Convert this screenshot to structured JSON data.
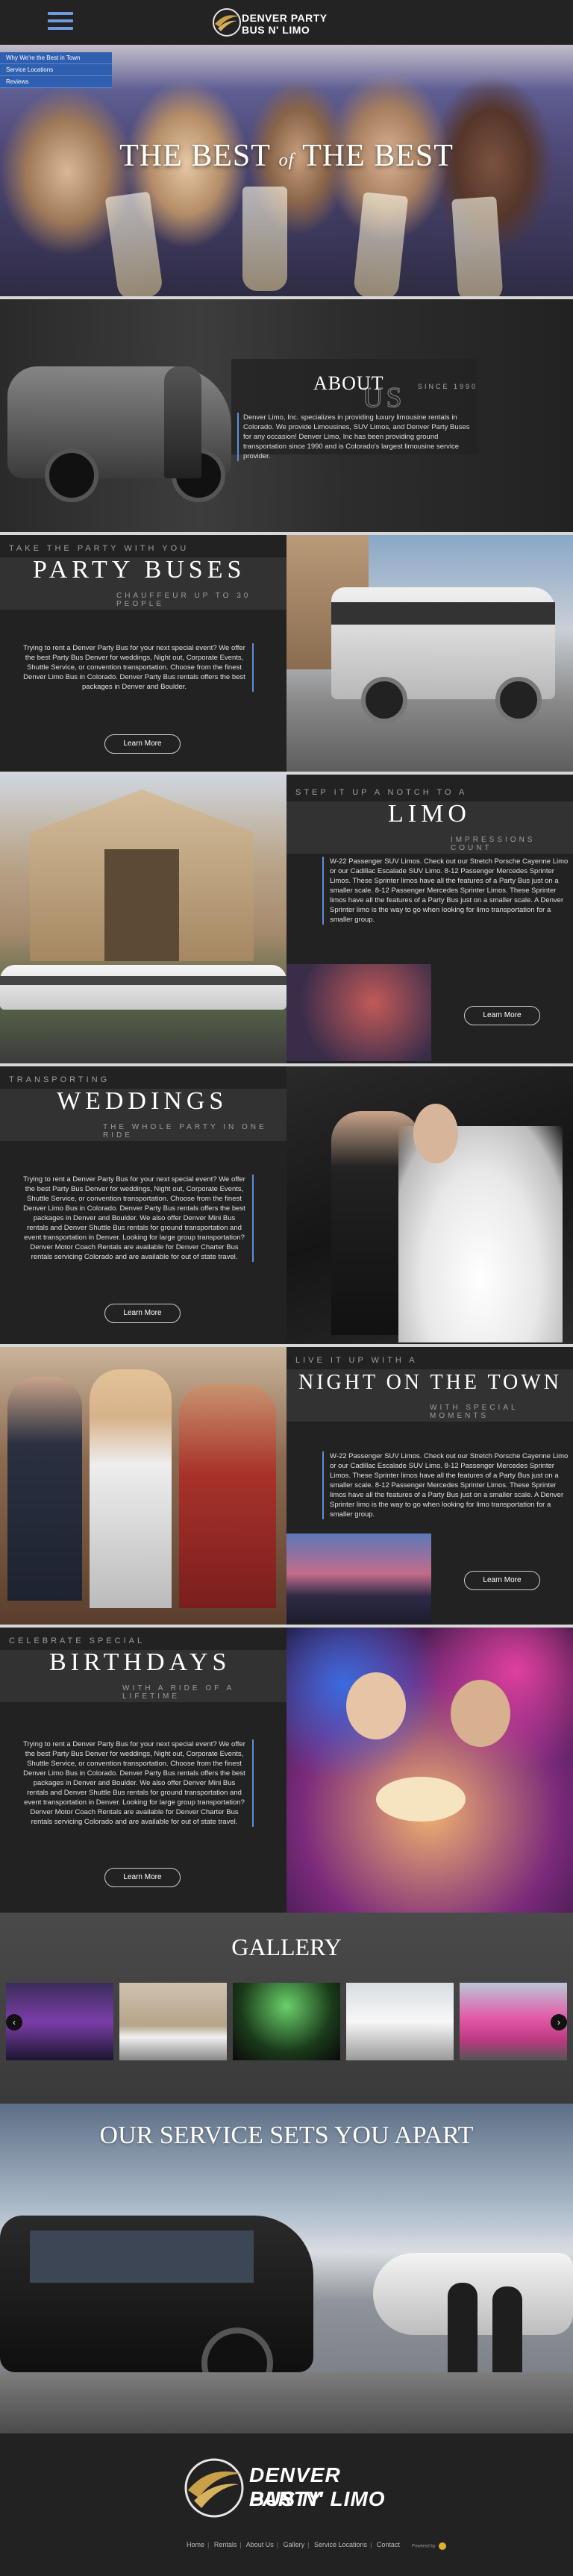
{
  "header": {
    "logo_line1": "DENVER PARTY",
    "logo_line2": "BUS N' LIMO"
  },
  "menu": [
    "Why We're the Best in Town",
    "Service Locations",
    "Reviews"
  ],
  "hero": {
    "title_part1": "THE BEST",
    "title_of": "of",
    "title_part2": "THE BEST"
  },
  "about": {
    "title": "ABOUT",
    "us": "US",
    "since": "SINCE 1990",
    "text": "Denver Limo, Inc. specializes in providing luxury limousine rentals in Colorado. We provide Limousines, SUV Limos, and Denver Party Buses for any occasion! Denver Limo, Inc has been providing ground transportation since 1990 and is Colorado's largest limousine service provider."
  },
  "sections": {
    "party_buses": {
      "eyebrow": "TAKE THE PARTY WITH YOU",
      "title": "PARTY BUSES",
      "subtitle": "CHAUFFEUR UP TO 30 PEOPLE",
      "text": "Trying to rent a Denver Party Bus for your next special event? We offer the best Party Bus Denver for weddings, Night out, Corporate Events, Shuttle Service, or convention transportation. Choose from the finest Denver Limo Bus in Colorado. Denver Party Bus rentals offers the best packages in Denver and Boulder.",
      "button": "Learn More"
    },
    "limo": {
      "eyebrow": "STEP IT UP A NOTCH TO A",
      "title": "LIMO",
      "subtitle": "IMPRESSIONS COUNT",
      "text": "W-22 Passenger SUV Limos. Check out our Stretch Porsche Cayenne Limo or our Cadillac Escalade SUV Limo. 8-12 Passenger Mercedes Sprinter Limos. These Sprinter limos have all the features of a Party Bus just on a smaller scale. 8-12 Passenger Mercedes Sprinter Limos. These Sprinter limos have all the features of a Party Bus just on a smaller scale. A Denver Sprinter limo is the way to go when looking for limo transportation for a smaller group.",
      "button": "Learn More"
    },
    "weddings": {
      "eyebrow": "TRANSPORTING",
      "title": "WEDDINGS",
      "subtitle": "THE WHOLE PARTY IN ONE RIDE",
      "text": "Trying to rent a Denver Party Bus for your next special event? We offer the best Party Bus Denver for weddings, Night out, Corporate Events, Shuttle Service, or convention transportation. Choose from the finest Denver Limo Bus in Colorado. Denver Party Bus rentals offers the best packages in Denver and Boulder. We also offer Denver Mini Bus rentals and Denver Shuttle Bus rentals for ground transportation and event transportation in Denver. Looking for large group transportation? Denver Motor Coach Rentals are available for Denver Charter Bus rentals servicing Colorado and are available for out of state travel.",
      "button": "Learn More"
    },
    "night": {
      "eyebrow": "LIVE IT UP WITH A",
      "title": "NIGHT ON THE TOWN",
      "subtitle": "WITH SPECIAL MOMENTS",
      "text": "W-22 Passenger SUV Limos. Check out our Stretch Porsche Cayenne Limo or our Cadillac Escalade SUV Limo. 8-12 Passenger Mercedes Sprinter Limos. These Sprinter limos have all the features of a Party Bus just on a smaller scale. 8-12 Passenger Mercedes Sprinter Limos. These Sprinter limos have all the features of a Party Bus just on a smaller scale. A Denver Sprinter limo is the way to go when looking for limo transportation for a smaller group.",
      "button": "Learn More"
    },
    "birthdays": {
      "eyebrow": "CELEBRATE SPECIAL",
      "title": "BIRTHDAYS",
      "subtitle": "WITH A RIDE OF A LIFETIME",
      "text": "Trying to rent a Denver Party Bus for your next special event? We offer the best Party Bus Denver for weddings, Night out, Corporate Events, Shuttle Service, or convention transportation. Choose from the finest Denver Limo Bus in Colorado. Denver Party Bus rentals offers the best packages in Denver and Boulder. We also offer Denver Mini Bus rentals and Denver Shuttle Bus rentals for ground transportation and event transportation in Denver. Looking for large group transportation? Denver Motor Coach Rentals are available for Denver Charter Bus rentals servicing Colorado and are available for out of state travel.",
      "button": "Learn More"
    }
  },
  "gallery": {
    "title": "GALLERY",
    "prev": "‹",
    "next": "›"
  },
  "service": {
    "title": "OUR SERVICE SETS YOU APART"
  },
  "footer": {
    "logo_line1": "DENVER PARTY",
    "logo_line2": "BUS N' LIMO",
    "links": [
      "Home",
      "Rentals",
      "About Us",
      "Gallery",
      "Service Locations",
      "Contact"
    ],
    "powered": "Powered by"
  }
}
